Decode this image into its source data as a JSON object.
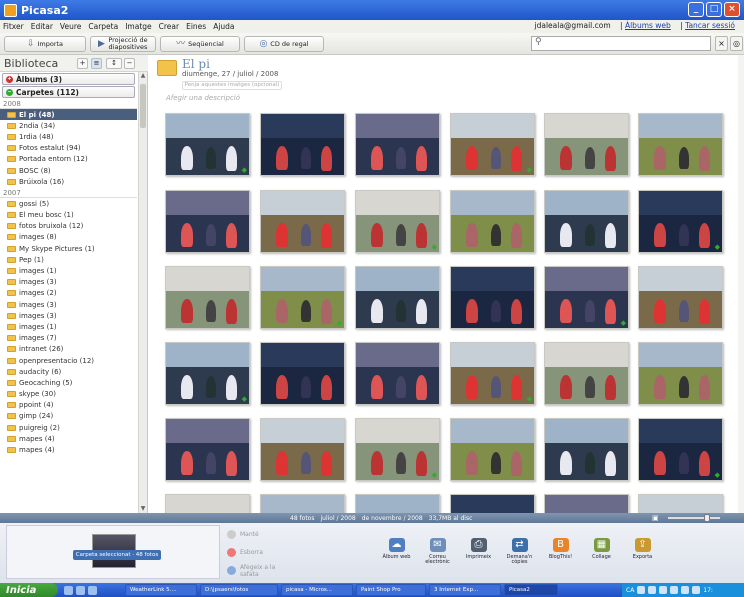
{
  "window": {
    "title": "Picasa2"
  },
  "menu": {
    "items": [
      "Fitxer",
      "Editar",
      "Veure",
      "Carpeta",
      "Imatge",
      "Crear",
      "Eines",
      "Ajuda"
    ],
    "account": "jdaleala@gmail.com",
    "link1": "Àlbums web",
    "link2": "Tancar sessió"
  },
  "toolbar": {
    "import": "Importa",
    "slideshow": "Projecció de diapositives",
    "timeline": "Seqüencial",
    "cd": "CD de regal",
    "search_value": ""
  },
  "sidebar": {
    "title": "Biblioteca",
    "albums": "Àlbums (3)",
    "folders": "Carpetes (112)",
    "groups": [
      {
        "year": "2008",
        "items": [
          "El pi (48)",
          "2ndia (34)",
          "1rdia (48)",
          "Fotos estalut (94)",
          "Portada entorn (12)",
          "BOSC (8)",
          "Brúixola (16)"
        ]
      },
      {
        "year": "2007",
        "items": [
          "gossi (5)",
          "El meu bosc (1)",
          "fotos bruixola (12)",
          "images (8)",
          "My Skype Pictures (1)",
          "Pep (1)",
          "images (1)",
          "images (3)",
          "images (2)",
          "images (3)",
          "images (3)",
          "images (1)",
          "images (7)",
          "intranet (26)",
          "openpresentacio (12)",
          "audacity (6)",
          "Geocaching (5)",
          "skype (30)",
          "ppoint (4)",
          "gimp (24)",
          "puigreig (2)",
          "mapes (4)",
          "mapes (4)"
        ]
      }
    ]
  },
  "album": {
    "title": "El pi",
    "date": "diumenge, 27 / juliol / 2008",
    "upload": "Penja aquestes imatges (opcional)",
    "description": "Afegir una descripció"
  },
  "status": {
    "count": "48 fotos",
    "month": "juliol / 2008",
    "range": "de novembre / 2008",
    "size": "33,7MB al disc"
  },
  "tray": {
    "label": "Carpeta seleccionat · 48 fotos",
    "hold": "Manté",
    "clear": "Esborra",
    "add": "Afegeix a la safata"
  },
  "actions": [
    {
      "label": "Àlbum web",
      "color": "#4f7fc0",
      "icon": "web-album-icon"
    },
    {
      "label": "Correu electrònic",
      "color": "#6f8fb8",
      "icon": "email-icon"
    },
    {
      "label": "Imprimeix",
      "color": "#506070",
      "icon": "print-icon"
    },
    {
      "label": "Demana'n còpies",
      "color": "#3f6fa8",
      "icon": "order-prints-icon"
    },
    {
      "label": "BlogThis!",
      "color": "#e8852a",
      "icon": "blog-icon"
    },
    {
      "label": "Collage",
      "color": "#7a9a40",
      "icon": "collage-icon"
    },
    {
      "label": "Exporta",
      "color": "#c89a30",
      "icon": "export-icon"
    }
  ],
  "taskbar": {
    "start": "Inicia",
    "tasks": [
      "WeatherLink 5....",
      "D:\\jpsaers\\fotos",
      "picasa - Micros...",
      "Paint Shop Pro",
      "3 Internet Exp...",
      "Picasa2"
    ],
    "lang": "CA",
    "clock": "17:"
  }
}
